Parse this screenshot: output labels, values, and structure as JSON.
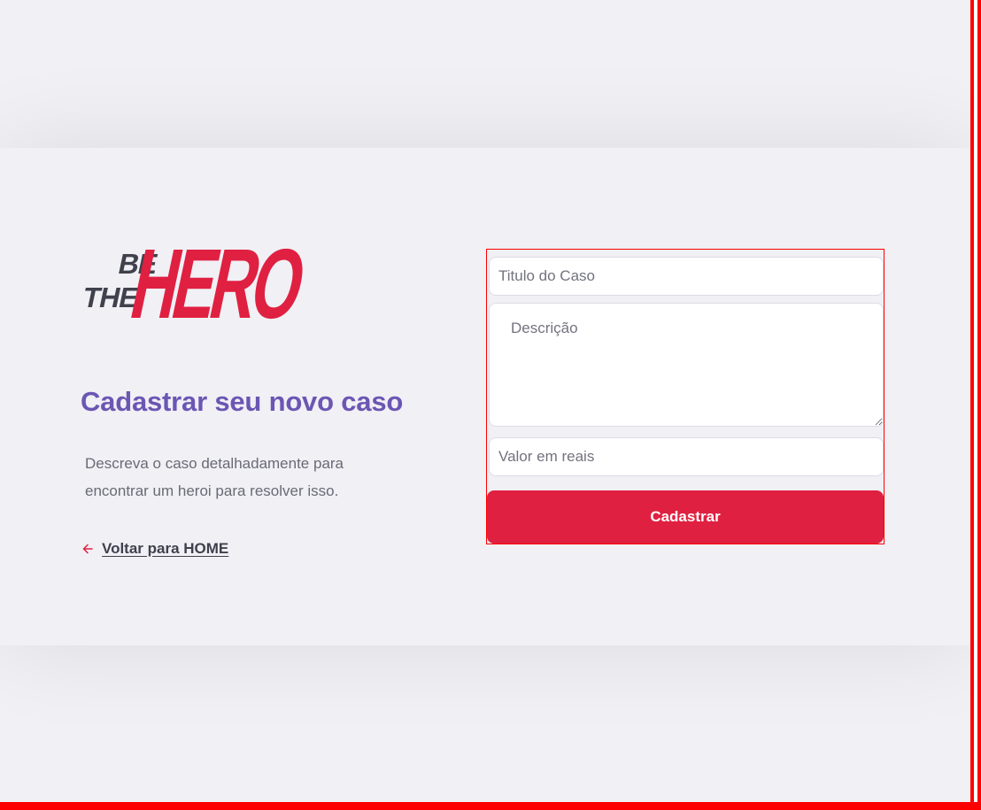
{
  "logo": {
    "line1": "BE",
    "line2": "THE",
    "word": "HERO",
    "dark_color": "#41414d",
    "brand_color": "#e02041"
  },
  "intro": {
    "title": "Cadastrar seu novo caso",
    "description": "Descreva o caso detalhadamente para encontrar um heroi para resolver isso.",
    "back_link": {
      "icon": "arrow-left-icon",
      "label": "Voltar para HOME"
    }
  },
  "form": {
    "title_field": {
      "placeholder": "Titulo do Caso",
      "value": ""
    },
    "description_field": {
      "placeholder": "Descrição",
      "value": ""
    },
    "value_field": {
      "placeholder": "Valor em reais",
      "value": ""
    },
    "submit_label": "Cadastrar"
  },
  "colors": {
    "background": "#f0f0f5",
    "accent_purple": "#6b56b3",
    "brand_red": "#e02041",
    "text_gray": "#737380",
    "frame_red": "#ff0000"
  }
}
